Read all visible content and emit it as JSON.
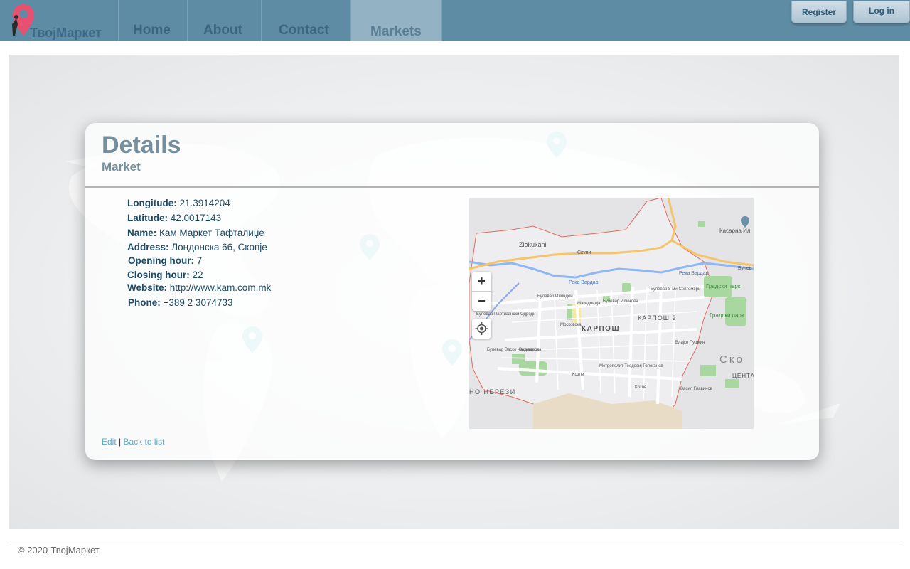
{
  "brand": {
    "name": "ТвојМаркет"
  },
  "nav": {
    "items": [
      {
        "label": "Home"
      },
      {
        "label": "About"
      },
      {
        "label": "Contact"
      },
      {
        "label": "Markets"
      }
    ],
    "active": "Markets",
    "register_label": "Register",
    "login_label": "Log in"
  },
  "details": {
    "title": "Details",
    "subtitle": "Market",
    "fields": [
      {
        "label": "Longitude:",
        "value": "21.3914204"
      },
      {
        "label": "Latitude:",
        "value": "42.0017143"
      },
      {
        "label": "Name:",
        "value": "Кам Маркет Тафталиџе"
      },
      {
        "label": "Address:",
        "value": "Лондонска 66, Скопје"
      },
      {
        "label": "Opening hour:",
        "value": "7"
      },
      {
        "label": "Closing hour:",
        "value": "22"
      },
      {
        "label": "Website:",
        "value": "http://www.kam.com.mk"
      },
      {
        "label": "Phone:",
        "value": "+389 2 3074733"
      }
    ],
    "edit_label": "Edit",
    "separator": "|",
    "back_label": "Back to list"
  },
  "map": {
    "zoom_in": "+",
    "zoom_out": "−",
    "labels": {
      "zlokukani": "Zlokukani",
      "karposh": "КАРПОШ",
      "karposh2": "КАРПОШ 2",
      "nerezi": "НО НЕРЕЗИ",
      "kasarna": "Касарна Ил",
      "gradski_park": "Градски парк",
      "gradski_park2": "Градски парк",
      "sko": "Ско",
      "centar": "ЦЕНТА",
      "reka": "Река Вардар",
      "skupi": "Скупи",
      "bulevar": "Булев",
      "ilinden": "Булевар Илинден",
      "ilinden2": "Булевар Илинден",
      "partizanski": "Булевар Партизански Одреди",
      "vaska": "Булевар Васко Чакаларов",
      "metropolit": "Метрополит Теодосиј Гологанов",
      "kozle": "Козле",
      "kozle2": "Козле",
      "vodnjanska": "Водњанска",
      "mosk": "Московска",
      "makedonija": "Македонија",
      "bulevar_s": "Булевар 8-ми Септември",
      "vasil": "Васил Главинов",
      "vlajko": "Влајко Пушкин"
    },
    "colors": {
      "river": "#8fb6f5",
      "road": "#f5c36a",
      "boundary": "#e36b5f",
      "park": "#a8d8a0"
    }
  },
  "footer": {
    "text": "© 2020-ТвојМаркет"
  },
  "colors": {
    "navbar": "#5e8ca5",
    "nav_active": "#93b3c4",
    "pin": "#e8506f",
    "map_pin": "#bfe4ea"
  }
}
